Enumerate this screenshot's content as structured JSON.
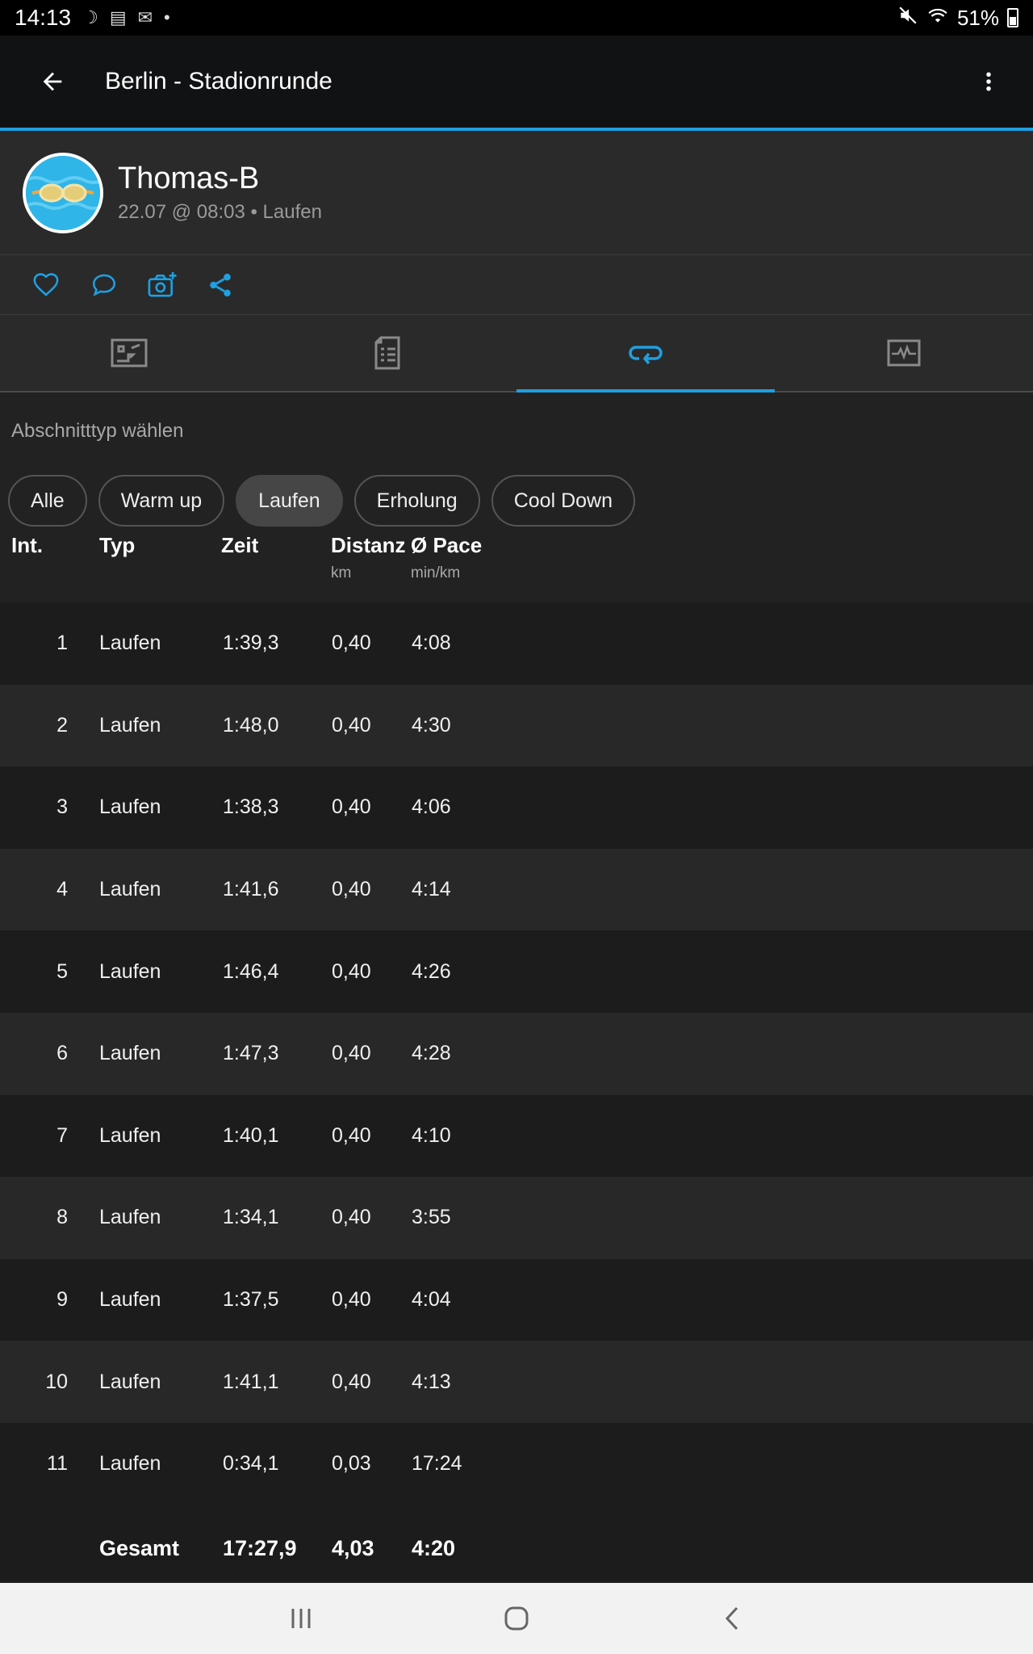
{
  "status_bar": {
    "time": "14:13",
    "battery": "51%"
  },
  "appbar": {
    "title": "Berlin - Stadionrunde"
  },
  "profile": {
    "name": "Thomas-B",
    "meta": "22.07 @ 08:03 • Laufen"
  },
  "section_label": "Abschnitttyp wählen",
  "filters": [
    "Alle",
    "Warm up",
    "Laufen",
    "Erholung",
    "Cool Down"
  ],
  "active_filter": "Laufen",
  "table": {
    "headers": {
      "int": "Int.",
      "typ": "Typ",
      "zeit": "Zeit",
      "distanz": "Distanz",
      "distanz_unit": "km",
      "pace": "Ø Pace",
      "pace_unit": "min/km"
    },
    "rows": [
      {
        "int": "1",
        "typ": "Laufen",
        "zeit": "1:39,3",
        "distanz": "0,40",
        "pace": "4:08"
      },
      {
        "int": "2",
        "typ": "Laufen",
        "zeit": "1:48,0",
        "distanz": "0,40",
        "pace": "4:30"
      },
      {
        "int": "3",
        "typ": "Laufen",
        "zeit": "1:38,3",
        "distanz": "0,40",
        "pace": "4:06"
      },
      {
        "int": "4",
        "typ": "Laufen",
        "zeit": "1:41,6",
        "distanz": "0,40",
        "pace": "4:14"
      },
      {
        "int": "5",
        "typ": "Laufen",
        "zeit": "1:46,4",
        "distanz": "0,40",
        "pace": "4:26"
      },
      {
        "int": "6",
        "typ": "Laufen",
        "zeit": "1:47,3",
        "distanz": "0,40",
        "pace": "4:28"
      },
      {
        "int": "7",
        "typ": "Laufen",
        "zeit": "1:40,1",
        "distanz": "0,40",
        "pace": "4:10"
      },
      {
        "int": "8",
        "typ": "Laufen",
        "zeit": "1:34,1",
        "distanz": "0,40",
        "pace": "3:55"
      },
      {
        "int": "9",
        "typ": "Laufen",
        "zeit": "1:37,5",
        "distanz": "0,40",
        "pace": "4:04"
      },
      {
        "int": "10",
        "typ": "Laufen",
        "zeit": "1:41,1",
        "distanz": "0,40",
        "pace": "4:13"
      },
      {
        "int": "11",
        "typ": "Laufen",
        "zeit": "0:34,1",
        "distanz": "0,03",
        "pace": "17:24"
      }
    ],
    "total": {
      "label": "Gesamt",
      "zeit": "17:27,9",
      "distanz": "4,03",
      "pace": "4:20"
    }
  },
  "colors": {
    "accent": "#1ea0e1",
    "background": "#222222",
    "appbar": "#111214"
  },
  "icons": {
    "back": "arrow-left-icon",
    "more": "more-vertical-icon",
    "like": "heart-icon",
    "comment": "comment-icon",
    "photo": "camera-plus-icon",
    "share": "share-icon",
    "tabs": [
      "map-icon",
      "document-icon",
      "laps-icon",
      "chart-icon"
    ]
  }
}
